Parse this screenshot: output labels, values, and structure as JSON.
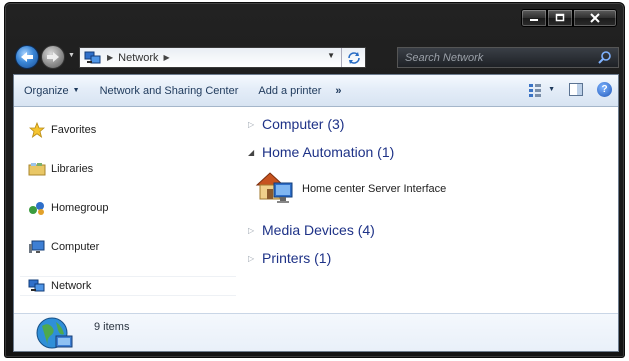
{
  "window": {
    "caption_buttons": [
      "minimize",
      "maximize",
      "close"
    ]
  },
  "address": {
    "path": "Network"
  },
  "search": {
    "placeholder": "Search Network"
  },
  "toolbar": {
    "organize": "Organize",
    "network_sharing": "Network and Sharing Center",
    "add_printer": "Add a printer",
    "more": "»"
  },
  "nav": {
    "items": [
      {
        "label": "Favorites",
        "icon": "star-icon"
      },
      {
        "label": "Libraries",
        "icon": "libraries-icon"
      },
      {
        "label": "Homegroup",
        "icon": "homegroup-icon"
      },
      {
        "label": "Computer",
        "icon": "computer-icon"
      },
      {
        "label": "Network",
        "icon": "network-icon"
      }
    ]
  },
  "groups": [
    {
      "label": "Computer (3)",
      "expanded": false
    },
    {
      "label": "Home Automation (1)",
      "expanded": true
    },
    {
      "label": "Media Devices (4)",
      "expanded": false
    },
    {
      "label": "Printers (1)",
      "expanded": false
    }
  ],
  "devices": [
    {
      "label": "Home center Server Interface",
      "icon": "home-server-icon"
    }
  ],
  "details": {
    "count": "9 items"
  },
  "colors": {
    "group_header": "#1e3287",
    "command_text": "#1e395b",
    "frame": "#1a1a1a"
  }
}
